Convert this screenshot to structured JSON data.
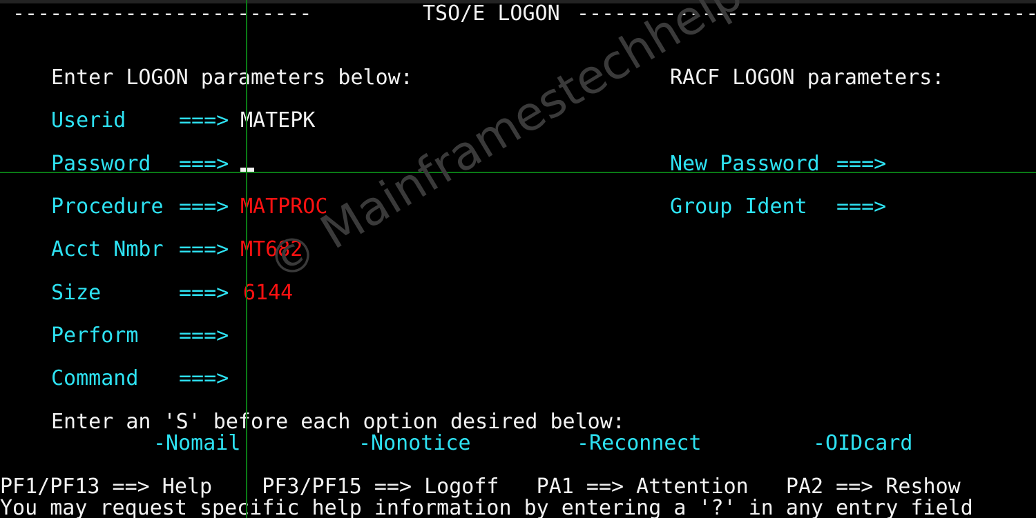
{
  "terminal": {
    "type": "ibm-3270-tso-logon",
    "columns": 80,
    "colors": {
      "background": "#000000",
      "protected_text": "#f2f2f2",
      "field_label": "#2ee2f2",
      "field_value": "#fe1111",
      "rule": "#0a7a15",
      "watermark": "#3a3a3a"
    }
  },
  "header": {
    "left_rule": "------------------------",
    "title": "TSO/E LOGON",
    "right_rule": "-------------------------------------"
  },
  "left_panel": {
    "heading": "Enter LOGON parameters below:",
    "arrow": "===>",
    "fields": [
      {
        "label": "Userid",
        "arrow": "===>",
        "value": "MATEPK",
        "value_color": "white",
        "cursor": false
      },
      {
        "label": "Password",
        "arrow": "===>",
        "value": "",
        "value_color": "white",
        "cursor": true
      },
      {
        "label": "Procedure",
        "arrow": "===>",
        "value": "MATPROC",
        "value_color": "red",
        "cursor": false
      },
      {
        "label": "Acct Nmbr",
        "arrow": "===>",
        "value": "MT682",
        "value_color": "red",
        "cursor": false
      },
      {
        "label": "Size",
        "arrow": "===>",
        "value": "6144",
        "value_color": "red",
        "cursor": false
      },
      {
        "label": "Perform",
        "arrow": "===>",
        "value": "",
        "value_color": "red",
        "cursor": false
      },
      {
        "label": "Command",
        "arrow": "===>",
        "value": "",
        "value_color": "red",
        "cursor": false
      }
    ]
  },
  "right_panel": {
    "heading": "RACF LOGON parameters:",
    "fields": [
      {
        "label": "New Password",
        "arrow": "===>",
        "value": ""
      },
      {
        "label": "Group Ident",
        "arrow": "===>",
        "value": ""
      }
    ]
  },
  "options": {
    "instruction": "Enter an 'S' before each option desired below:",
    "items": [
      {
        "label": "-Nomail"
      },
      {
        "label": "-Nonotice"
      },
      {
        "label": "-Reconnect"
      },
      {
        "label": "-OIDcard"
      }
    ]
  },
  "footer": {
    "pfkeys": [
      {
        "key": "PF1/PF13",
        "arrow": "==>",
        "action": "Help"
      },
      {
        "key": "PF3/PF15",
        "arrow": "==>",
        "action": "Logoff"
      },
      {
        "key": "PA1",
        "arrow": "==>",
        "action": "Attention"
      },
      {
        "key": "PA2",
        "arrow": "==>",
        "action": "Reshow"
      }
    ],
    "pfkey_line": "PF1/PF13 ==> Help    PF3/PF15 ==> Logoff   PA1 ==> Attention   PA2 ==> Reshow",
    "help_line": "You may request specific help information by entering a '?' in any entry field"
  },
  "watermark": {
    "text": "© Mainframestechhelp"
  }
}
